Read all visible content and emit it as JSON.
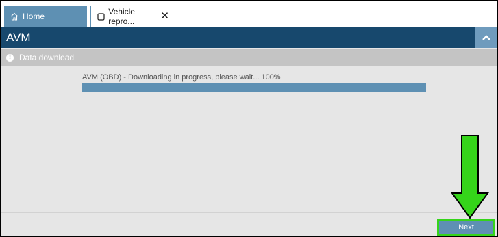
{
  "tabs": [
    {
      "label": "Home",
      "icon": "home-icon"
    },
    {
      "label": "Vehicle repro...",
      "icon": "window-icon",
      "close_icon": "close-icon"
    }
  ],
  "header": {
    "title": "AVM",
    "collapse_icon": "chevron-up-icon"
  },
  "section": {
    "title": "Data download",
    "icon": "info-icon"
  },
  "progress": {
    "label": "AVM (OBD) - Downloading in progress, please wait... 100%",
    "value": 1.0
  },
  "footer": {
    "next_label": "Next"
  },
  "annotation": {
    "arrow_icon": "arrow-down-icon",
    "color": "#35d41a"
  },
  "colors": {
    "accent": "#5e90b3",
    "header": "#17486d",
    "highlight": "#35d41a"
  }
}
